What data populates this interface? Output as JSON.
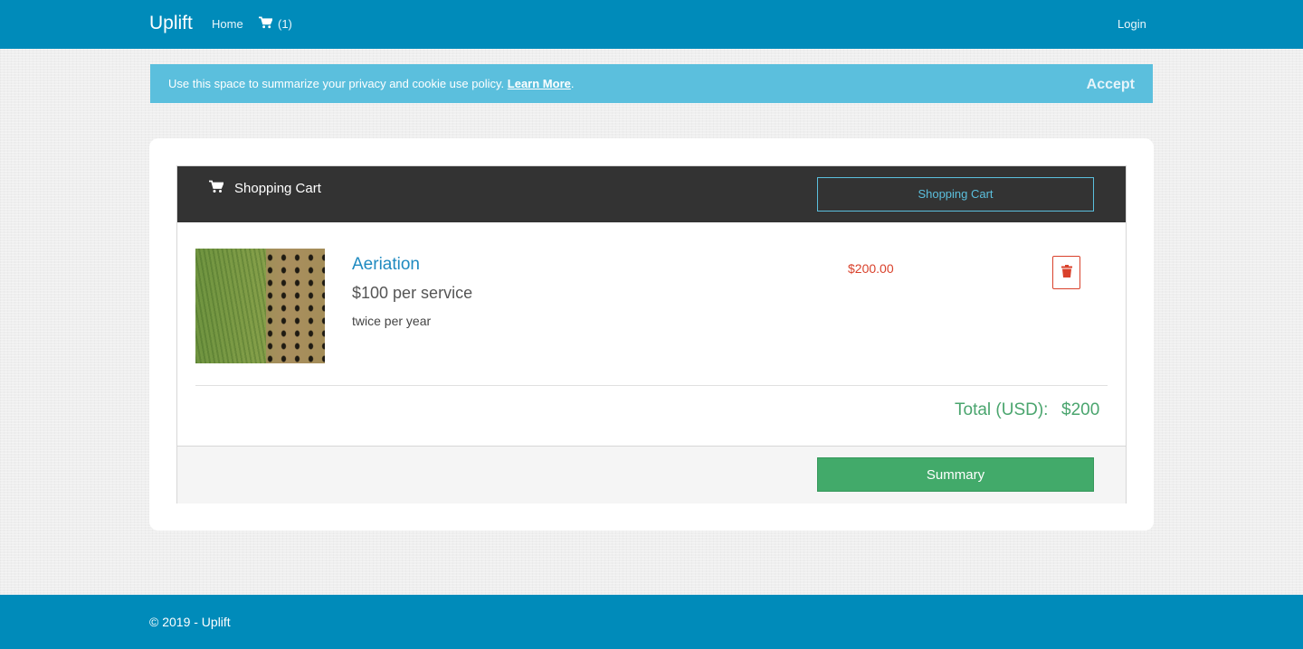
{
  "navbar": {
    "brand": "Uplift",
    "home": "Home",
    "cart_count": "(1)",
    "login": "Login"
  },
  "cookie": {
    "text": "Use this space to summarize your privacy and cookie use policy.",
    "learn_more": "Learn More",
    "after_link": ".",
    "accept": "Accept"
  },
  "cart": {
    "title": "Shopping Cart",
    "header_button": "Shopping Cart",
    "items": [
      {
        "name": "Aeriation",
        "rate": "$100 per service",
        "frequency": "twice per year",
        "price": "$200.00",
        "image": "aeration-lawn-photo"
      }
    ],
    "total_label": "Total (USD):",
    "total_value": "$200",
    "summary_button": "Summary"
  },
  "footer": {
    "text": "© 2019 - Uplift"
  },
  "colors": {
    "brand_blue": "#008bba",
    "banner_blue": "#5bbfdd",
    "header_dark": "#333333",
    "price_red": "#d9412b",
    "total_green": "#4aa56e",
    "summary_green": "#42aa6a"
  },
  "icons": {
    "cart": "shopping-cart-icon",
    "delete": "trash-icon"
  }
}
